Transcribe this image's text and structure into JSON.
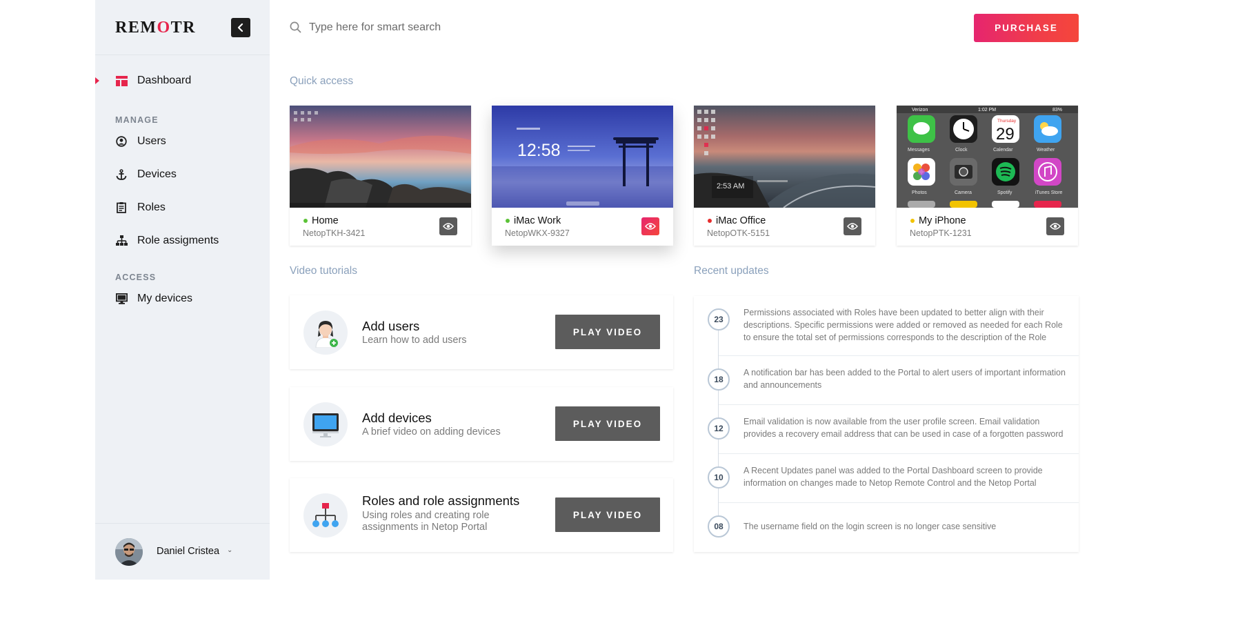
{
  "brand": {
    "logo_pre": "REM",
    "logo_accent": "O",
    "logo_post": "TR",
    "accent_color": "#e6254c"
  },
  "sidebar": {
    "items": [
      {
        "label": "Dashboard",
        "icon": "dashboard-icon"
      },
      {
        "label": "Users",
        "icon": "user-circle-icon"
      },
      {
        "label": "Devices",
        "icon": "anchor-icon"
      },
      {
        "label": "Roles",
        "icon": "clipboard-list-icon"
      },
      {
        "label": "Role assigments",
        "icon": "sitemap-icon"
      },
      {
        "label": "My devices",
        "icon": "monitor-icon"
      }
    ],
    "sections": {
      "manage": "MANAGE",
      "access": "ACCESS"
    },
    "profile": {
      "name": "Daniel Cristea",
      "caret": "⌄"
    }
  },
  "header": {
    "search_placeholder": "Type here for smart search",
    "purchase_label": "PURCHASE"
  },
  "quick_access": {
    "title": "Quick access",
    "devices": [
      {
        "name": "Home",
        "id": "NetopTKH-3421",
        "status_color": "#5bc236"
      },
      {
        "name": "iMac Work",
        "id": "NetopWKX-9327",
        "status_color": "#5bc236",
        "active": true,
        "screen_time": "12:58"
      },
      {
        "name": "iMac Office",
        "id": "NetopOTK-5151",
        "status_color": "#e62d2d",
        "screen_time": "2:53 AM"
      },
      {
        "name": "My iPhone",
        "id": "NetopPTK-1231",
        "status_color": "#f2c300",
        "phone": {
          "carrier": "Verizon",
          "time": "1:02 PM",
          "battery": "83%",
          "calendar_day": "Thursday",
          "calendar_date": "29",
          "apps": [
            "Messages",
            "Clock",
            "Calendar",
            "Weather",
            "Photos",
            "Camera",
            "Spotify",
            "iTunes Store"
          ]
        }
      }
    ]
  },
  "video_tutorials": {
    "title": "Video tutorials",
    "items": [
      {
        "title": "Add users",
        "desc": "Learn how to add users",
        "button": "PLAY VIDEO",
        "icon": "add-user-avatar-icon"
      },
      {
        "title": "Add devices",
        "desc": "A brief video on adding devices",
        "button": "PLAY VIDEO",
        "icon": "desktop-monitor-icon"
      },
      {
        "title": "Roles and role assignments",
        "desc": "Using roles and creating role assignments in Netop Portal",
        "button": "PLAY VIDEO",
        "icon": "org-chart-icon"
      }
    ]
  },
  "recent_updates": {
    "title": "Recent updates",
    "items": [
      {
        "num": "23",
        "text": "Permissions associated with Roles have been updated to better align with their descriptions. Specific permissions were added or removed as needed for each Role to ensure the total set of permissions corresponds to the description of the Role"
      },
      {
        "num": "18",
        "text": "A notification bar has been added to the Portal to alert users of important information and announcements"
      },
      {
        "num": "12",
        "text": "Email validation is now available from the user profile screen. Email validation provides a recovery email address that can be used in case of a forgotten password"
      },
      {
        "num": "10",
        "text": "A Recent Updates panel was added to the Portal Dashboard screen to provide information on changes made to Netop Remote Control and the Netop Portal"
      },
      {
        "num": "08",
        "text": "The username field on the login screen is no longer case sensitive"
      }
    ]
  }
}
